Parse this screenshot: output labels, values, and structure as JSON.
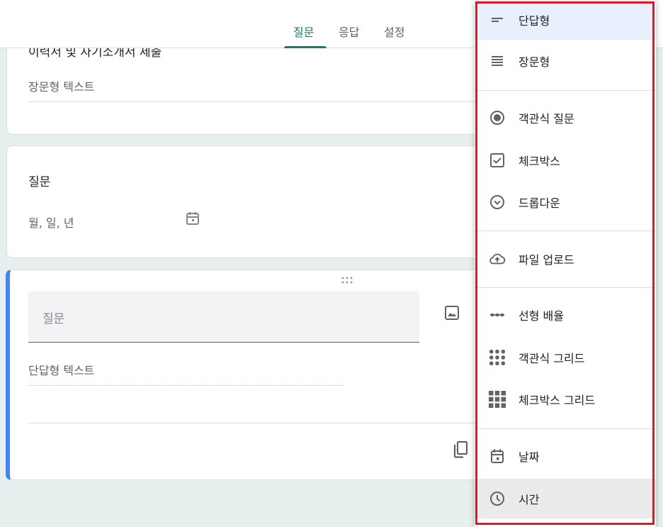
{
  "header": {
    "tabs": [
      {
        "label": "질문",
        "active": true
      },
      {
        "label": "응답",
        "active": false
      },
      {
        "label": "설정",
        "active": false
      }
    ]
  },
  "cards": {
    "card1": {
      "title_cut": "이력서 및 자기소개서 제출",
      "answer_placeholder": "장문형 텍스트"
    },
    "card2": {
      "title": "질문",
      "date_hint": "월, 일, 년"
    },
    "card3": {
      "question_placeholder": "질문",
      "answer_placeholder": "단답형 텍스트"
    }
  },
  "menu": {
    "items": [
      {
        "label": "단답형",
        "icon": "short-answer-icon"
      },
      {
        "label": "장문형",
        "icon": "paragraph-icon"
      },
      {
        "label": "객관식 질문",
        "icon": "radio-icon"
      },
      {
        "label": "체크박스",
        "icon": "checkbox-icon"
      },
      {
        "label": "드롭다운",
        "icon": "dropdown-icon"
      },
      {
        "label": "파일 업로드",
        "icon": "upload-icon"
      },
      {
        "label": "선형 배율",
        "icon": "linear-scale-icon"
      },
      {
        "label": "객관식 그리드",
        "icon": "radio-grid-icon"
      },
      {
        "label": "체크박스 그리드",
        "icon": "checkbox-grid-icon"
      },
      {
        "label": "날짜",
        "icon": "calendar-icon"
      },
      {
        "label": "시간",
        "icon": "clock-icon"
      }
    ],
    "selected": "단답형",
    "hovered": "시간"
  },
  "colors": {
    "accent": "#1a7b6e",
    "active_border": "#4285f4",
    "highlight_outline": "#e2171f"
  }
}
